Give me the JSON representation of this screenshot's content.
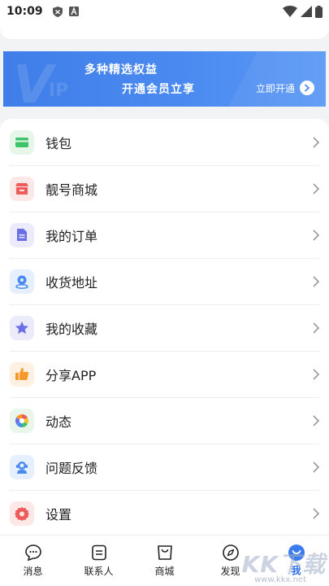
{
  "status_bar": {
    "time": "10:09"
  },
  "vip_banner": {
    "deco_v": "V",
    "deco_ip": "IP",
    "title": "多种精选权益",
    "subtitle": "开通会员立享",
    "action_label": "立即开通"
  },
  "menu": {
    "items": [
      {
        "label": "钱包",
        "icon": "wallet-icon",
        "color": "#3cc46a",
        "bg": "#e6f7ea"
      },
      {
        "label": "靓号商城",
        "icon": "store-icon",
        "color": "#ef5a5a",
        "bg": "#fde8e8"
      },
      {
        "label": "我的订单",
        "icon": "order-icon",
        "color": "#6b6fe6",
        "bg": "#ebebfb"
      },
      {
        "label": "收货地址",
        "icon": "location-icon",
        "color": "#4a8af0",
        "bg": "#e6effd"
      },
      {
        "label": "我的收藏",
        "icon": "star-icon",
        "color": "#6b6fe6",
        "bg": "#ebebfb"
      },
      {
        "label": "分享APP",
        "icon": "thumbs-up-icon",
        "color": "#f59a2a",
        "bg": "#fef1e2"
      },
      {
        "label": "动态",
        "icon": "moments-icon",
        "color": "#f0a030",
        "bg": "#eaf6ec"
      },
      {
        "label": "问题反馈",
        "icon": "feedback-icon",
        "color": "#4a8af0",
        "bg": "#e6effd"
      },
      {
        "label": "设置",
        "icon": "gear-icon",
        "color": "#ef5a5a",
        "bg": "#fde8e8"
      }
    ]
  },
  "tab_bar": {
    "tabs": [
      {
        "label": "消息",
        "icon": "message-icon"
      },
      {
        "label": "联系人",
        "icon": "contacts-icon"
      },
      {
        "label": "商城",
        "icon": "shop-bag-icon"
      },
      {
        "label": "发现",
        "icon": "compass-icon"
      },
      {
        "label": "我",
        "icon": "me-icon",
        "active": true
      }
    ]
  },
  "watermark": {
    "text": "KK下载",
    "url": "www.kkx.net"
  },
  "colors": {
    "accent": "#2b6de8",
    "banner": "#4a8af0"
  }
}
